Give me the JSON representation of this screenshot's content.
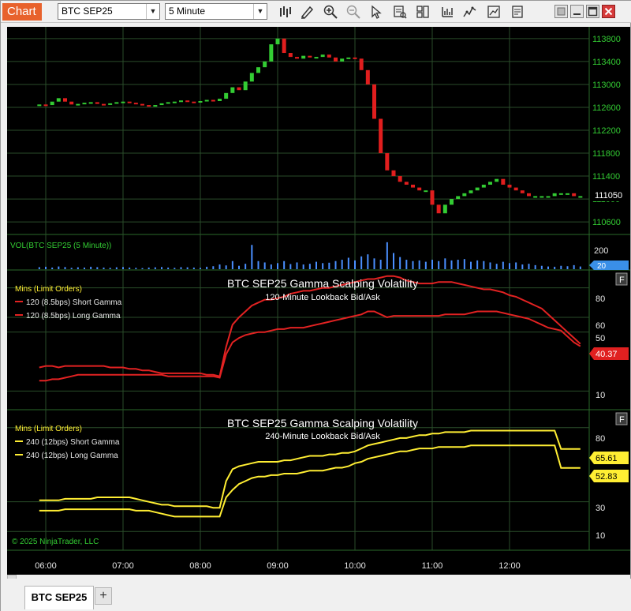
{
  "window": {
    "app_title": "Chart",
    "instrument": "BTC SEP25",
    "interval": "5 Minute",
    "tab_label": "BTC SEP25",
    "add_tab_label": "+"
  },
  "toolbar": {
    "icons": [
      "bar-type-icon",
      "drawing-tool-icon",
      "zoom-in-icon",
      "zoom-out-icon",
      "pointer-icon",
      "data-box-icon",
      "templates-icon",
      "strategies-icon",
      "indicators-icon",
      "chart-properties-icon",
      "attach-order-icon"
    ],
    "window_buttons": [
      "restore-icon",
      "minimize-icon",
      "maximize-icon",
      "close-icon"
    ]
  },
  "colors": {
    "up_candle": "#33cc33",
    "down_candle": "#e11e1e",
    "volume": "#4a8fff",
    "red_plot": "#e22222",
    "yellow_plot": "#ffee33",
    "grid": "#2a4d2a",
    "axis_text": "#e6e6e6",
    "green_label": "#33cc33",
    "copyright": "#33cc33"
  },
  "price_panel": {
    "ticks": [
      113800,
      113400,
      113000,
      112600,
      112200,
      111800,
      111400,
      111000,
      110600
    ],
    "last_price_label": "111050"
  },
  "volume_panel": {
    "label": "VOL(BTC SEP25 (5 Minute))",
    "ticks": [
      "200"
    ],
    "last_label": "20"
  },
  "gamma_panel_120": {
    "title": "BTC SEP25 Gamma Scalping Volatility",
    "subtitle": "120-Minute Lookback Bid/Ask",
    "legend_title": "Mins (Limit Orders)",
    "legend": [
      "120 (8.5bps) Short Gamma",
      "120 (8.5bps) Long Gamma"
    ],
    "ticks": [
      "80",
      "60",
      "50",
      "10"
    ],
    "last_label": "40.37",
    "f_label": "F"
  },
  "gamma_panel_240": {
    "title": "BTC SEP25 Gamma Scalping Volatility",
    "subtitle": "240-Minute Lookback Bid/Ask",
    "legend_title": "Mins (Limit Orders)",
    "legend": [
      "240 (12bps) Short Gamma",
      "240 (12bps) Long Gamma"
    ],
    "ticks": [
      "80",
      "30",
      "10"
    ],
    "last_labels": [
      "65.61",
      "52.83"
    ],
    "f_label": "F"
  },
  "time_axis": [
    "06:00",
    "07:00",
    "08:00",
    "09:00",
    "10:00",
    "11:00",
    "12:00"
  ],
  "copyright": "© 2025 NinjaTrader, LLC",
  "chart_data": {
    "type": "candlestick",
    "x": [
      "05:55",
      "06:00",
      "06:05",
      "06:10",
      "06:15",
      "06:20",
      "06:25",
      "06:30",
      "06:35",
      "06:40",
      "06:45",
      "06:50",
      "06:55",
      "07:00",
      "07:05",
      "07:10",
      "07:15",
      "07:20",
      "07:25",
      "07:30",
      "07:35",
      "07:40",
      "07:45",
      "07:50",
      "07:55",
      "08:00",
      "08:05",
      "08:10",
      "08:15",
      "08:20",
      "08:25",
      "08:30",
      "08:35",
      "08:40",
      "08:45",
      "08:50",
      "08:55",
      "09:00",
      "09:05",
      "09:10",
      "09:15",
      "09:20",
      "09:25",
      "09:30",
      "09:35",
      "09:40",
      "09:45",
      "09:50",
      "09:55",
      "10:00",
      "10:05",
      "10:10",
      "10:15",
      "10:20",
      "10:25",
      "10:30",
      "10:35",
      "10:40",
      "10:45",
      "10:50",
      "10:55",
      "11:00",
      "11:05",
      "11:10",
      "11:15",
      "11:20",
      "11:25",
      "11:30",
      "11:35",
      "11:40",
      "11:45",
      "11:50",
      "11:55",
      "12:00",
      "12:05",
      "12:10",
      "12:15",
      "12:20",
      "12:25",
      "12:30",
      "12:35",
      "12:40",
      "12:45",
      "12:50",
      "12:55"
    ],
    "open": [
      112630,
      112650,
      112640,
      112700,
      112760,
      112700,
      112650,
      112660,
      112680,
      112690,
      112660,
      112650,
      112670,
      112690,
      112700,
      112680,
      112660,
      112640,
      112620,
      112640,
      112670,
      112690,
      112700,
      112720,
      112700,
      112690,
      112710,
      112730,
      112710,
      112750,
      112850,
      112950,
      112900,
      113050,
      113200,
      113300,
      113400,
      113700,
      113800,
      113550,
      113480,
      113450,
      113500,
      113470,
      113480,
      113520,
      113470,
      113400,
      113450,
      113470,
      113450,
      113250,
      113000,
      112400,
      111800,
      111500,
      111400,
      111300,
      111250,
      111200,
      111150,
      111150,
      110900,
      110750,
      110900,
      111000,
      111050,
      111100,
      111150,
      111200,
      111250,
      111300,
      111350,
      111250,
      111200,
      111150,
      111100,
      111050,
      111050,
      111050,
      111050,
      111100,
      111100,
      111100,
      111050
    ],
    "close": [
      112650,
      112640,
      112700,
      112760,
      112700,
      112650,
      112660,
      112680,
      112690,
      112660,
      112650,
      112670,
      112690,
      112700,
      112680,
      112660,
      112640,
      112620,
      112640,
      112670,
      112690,
      112700,
      112720,
      112700,
      112690,
      112710,
      112730,
      112710,
      112750,
      112850,
      112950,
      112900,
      113050,
      113200,
      113300,
      113400,
      113700,
      113800,
      113550,
      113480,
      113450,
      113500,
      113470,
      113480,
      113520,
      113470,
      113400,
      113450,
      113470,
      113450,
      113250,
      113000,
      112400,
      111800,
      111500,
      111400,
      111300,
      111250,
      111200,
      111150,
      111150,
      110900,
      110750,
      110900,
      111000,
      111050,
      111100,
      111150,
      111200,
      111250,
      111300,
      111350,
      111250,
      111200,
      111150,
      111100,
      111050,
      111050,
      111050,
      111050,
      111100,
      111100,
      111100,
      111050,
      111050
    ],
    "volume": [
      15,
      18,
      12,
      20,
      16,
      10,
      14,
      12,
      18,
      15,
      12,
      10,
      14,
      16,
      12,
      10,
      8,
      12,
      14,
      16,
      12,
      10,
      15,
      14,
      12,
      10,
      18,
      22,
      35,
      28,
      60,
      25,
      40,
      180,
      60,
      50,
      35,
      45,
      60,
      38,
      50,
      35,
      40,
      55,
      45,
      48,
      60,
      70,
      85,
      65,
      95,
      110,
      80,
      70,
      200,
      120,
      90,
      70,
      60,
      65,
      55,
      70,
      60,
      80,
      65,
      70,
      75,
      55,
      65,
      60,
      50,
      40,
      55,
      45,
      50,
      35,
      40,
      30,
      25,
      20,
      18,
      25,
      22,
      30,
      20
    ],
    "red_short_gamma": [
      26,
      27,
      27,
      26,
      27,
      27,
      27,
      27,
      27,
      27,
      27,
      26,
      26,
      26,
      25,
      25,
      24,
      24,
      23,
      22,
      22,
      22,
      22,
      22,
      22,
      22,
      21,
      21,
      20,
      40,
      55,
      60,
      64,
      68,
      70,
      72,
      72,
      73,
      74,
      76,
      77,
      78,
      78,
      79,
      80,
      80,
      81,
      82,
      83,
      84,
      85,
      86,
      86,
      87,
      88,
      88,
      87,
      85,
      84,
      83,
      83,
      83,
      84,
      84,
      84,
      83,
      82,
      81,
      80,
      79,
      79,
      78,
      77,
      75,
      74,
      72,
      70,
      68,
      66,
      62,
      58,
      54,
      50,
      46,
      42
    ],
    "red_long_gamma": [
      17,
      17,
      18,
      18,
      19,
      20,
      21,
      21,
      21,
      21,
      21,
      21,
      21,
      21,
      21,
      21,
      21,
      21,
      21,
      21,
      20,
      20,
      20,
      20,
      20,
      20,
      20,
      20,
      19,
      35,
      43,
      46,
      48,
      49,
      50,
      50,
      51,
      52,
      52,
      53,
      53,
      53,
      54,
      55,
      56,
      57,
      58,
      59,
      60,
      61,
      62,
      64,
      64,
      62,
      60,
      61,
      61,
      61,
      61,
      61,
      61,
      61,
      61,
      62,
      62,
      62,
      62,
      63,
      64,
      64,
      64,
      64,
      63,
      62,
      61,
      60,
      59,
      57,
      55,
      53,
      52,
      51,
      47,
      43,
      40.37
    ],
    "yellow_short_gamma": [
      31,
      31,
      31,
      31,
      32,
      32,
      32,
      32,
      32,
      33,
      33,
      33,
      33,
      33,
      33,
      32,
      31,
      30,
      29,
      28,
      28,
      27,
      27,
      27,
      27,
      27,
      27,
      26,
      26,
      44,
      52,
      54,
      55,
      56,
      57,
      57,
      57,
      57,
      58,
      58,
      59,
      60,
      61,
      61,
      61,
      62,
      62,
      63,
      63,
      64,
      66,
      68,
      69,
      70,
      71,
      72,
      73,
      73,
      74,
      75,
      75,
      76,
      76,
      77,
      77,
      77,
      77,
      78,
      78,
      78,
      78,
      78,
      78,
      78,
      78,
      78,
      78,
      78,
      78,
      78,
      78,
      65.61,
      65.61,
      65.61,
      65.61
    ],
    "yellow_long_gamma": [
      24,
      24,
      24,
      24,
      25,
      25,
      25,
      25,
      25,
      25,
      25,
      25,
      25,
      25,
      25,
      24,
      24,
      24,
      23,
      22,
      21,
      20,
      20,
      20,
      20,
      20,
      20,
      20,
      20,
      33,
      38,
      42,
      44,
      46,
      47,
      47,
      48,
      48,
      49,
      49,
      49,
      50,
      51,
      51,
      51,
      52,
      53,
      53,
      54,
      56,
      57,
      59,
      60,
      61,
      62,
      63,
      64,
      64,
      65,
      66,
      66,
      66,
      67,
      67,
      67,
      67,
      67,
      68,
      68,
      68,
      68,
      68,
      68,
      68,
      68,
      68,
      68,
      68,
      68,
      68,
      68,
      52.83,
      52.83,
      52.83,
      52.83
    ],
    "ylim_price": [
      110450,
      113950
    ],
    "ylim_volume": [
      0,
      240
    ],
    "ylim_gamma_120": [
      0,
      90
    ],
    "ylim_gamma_240": [
      0,
      90
    ]
  }
}
